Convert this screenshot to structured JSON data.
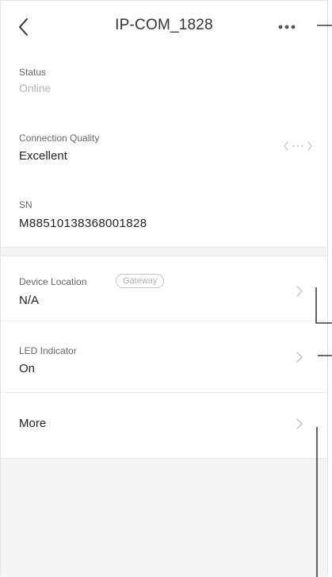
{
  "header": {
    "title": "IP-COM_1828"
  },
  "status": {
    "label": "Status",
    "value": "Online"
  },
  "connection_quality": {
    "label": "Connection Quality",
    "value": "Excellent"
  },
  "sn": {
    "label": "SN",
    "value": "M88510138368001828"
  },
  "device_location": {
    "label": "Device Location",
    "badge": "Gateway",
    "value": "N/A"
  },
  "led_indicator": {
    "label": "LED Indicator",
    "value": "On"
  },
  "more": {
    "label": "More"
  },
  "icons": {
    "back": "chevron-left-icon",
    "menu": "more-dots-icon",
    "signal": "connection-signal-icon",
    "row_arrow": "chevron-right-icon"
  },
  "colors": {
    "background": "#ffffff",
    "section_gap": "#f4f4f4",
    "muted_text": "#b7b7b7",
    "label_text": "#666666",
    "callout_line": "#111111"
  }
}
